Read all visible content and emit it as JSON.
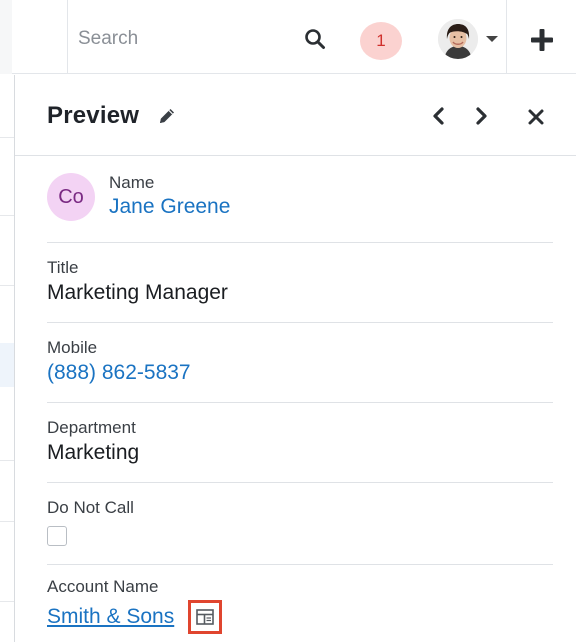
{
  "header": {
    "search_placeholder": "Search",
    "notification_count": "1",
    "icons": [
      "search-icon",
      "user-avatar",
      "chevron-down-icon",
      "plus-icon"
    ]
  },
  "preview": {
    "title": "Preview",
    "avatar_initials": "Co",
    "fields": {
      "name_label": "Name",
      "name_value": "Jane Greene",
      "title_label": "Title",
      "title_value": "Marketing Manager",
      "mobile_label": "Mobile",
      "mobile_value": "(888) 862-5837",
      "department_label": "Department",
      "department_value": "Marketing",
      "do_not_call_label": "Do Not Call",
      "do_not_call_checked": false,
      "account_name_label": "Account Name",
      "account_name_value": "Smith & Sons"
    }
  },
  "colors": {
    "link": "#1a73c2",
    "badge_bg": "#fbd2d0",
    "badge_text": "#d0312d",
    "avatar_bg": "#f3d3f4",
    "highlight_border": "#e0452f"
  }
}
